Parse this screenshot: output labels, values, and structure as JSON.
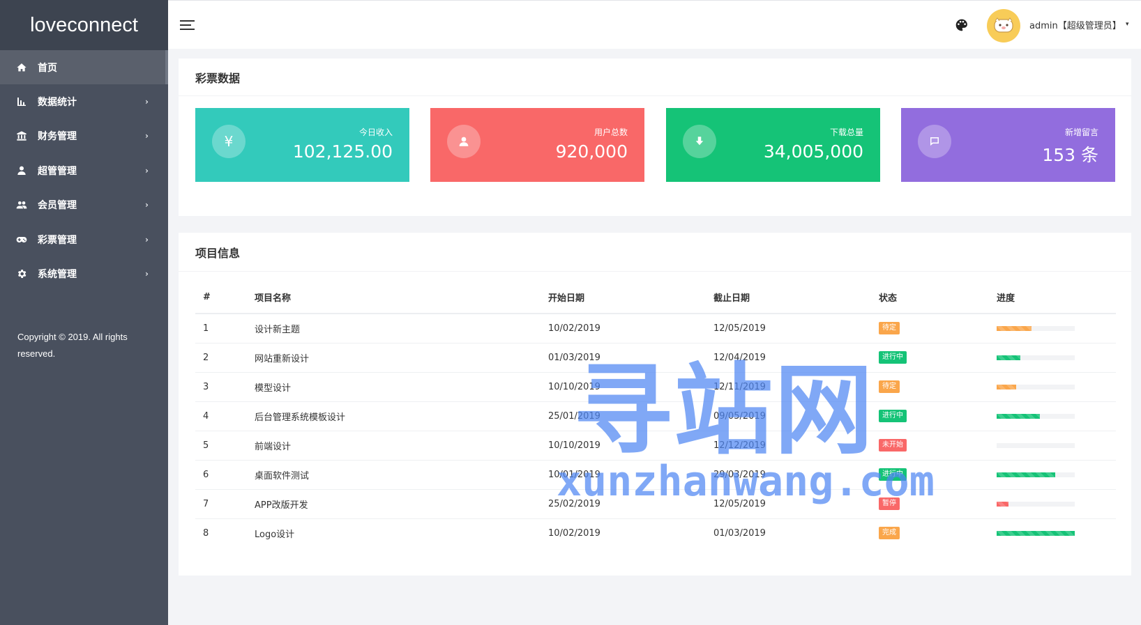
{
  "sidebar": {
    "logo": "loveconnect",
    "items": [
      {
        "label": "首页",
        "icon": "home-icon"
      },
      {
        "label": "数据统计",
        "icon": "bar-chart-icon"
      },
      {
        "label": "财务管理",
        "icon": "bank-icon"
      },
      {
        "label": "超管管理",
        "icon": "user-icon"
      },
      {
        "label": "会员管理",
        "icon": "users-icon"
      },
      {
        "label": "彩票管理",
        "icon": "gamepad-icon"
      },
      {
        "label": "系统管理",
        "icon": "gear-icon"
      }
    ],
    "copyright": "Copyright © 2019. All rights reserved."
  },
  "header": {
    "user": "admin【超级管理员】",
    "avatar_icon": "cartoon-avatar-icon",
    "palette_icon": "palette-icon",
    "caret": "▾"
  },
  "stats": {
    "title": "彩票数据",
    "cards": [
      {
        "label": "今日收入",
        "value": "102,125.00",
        "icon": "yen-icon",
        "glyph": "¥",
        "color": "#33cabb"
      },
      {
        "label": "用户总数",
        "value": "920,000",
        "icon": "user-icon",
        "color": "#f96868"
      },
      {
        "label": "下载总量",
        "value": "34,005,000",
        "icon": "download-icon",
        "color": "#15c377"
      },
      {
        "label": "新增留言",
        "value": "153 条",
        "icon": "message-icon",
        "color": "#926dde"
      }
    ]
  },
  "projects": {
    "title": "项目信息",
    "columns": [
      "#",
      "项目名称",
      "开始日期",
      "截止日期",
      "状态",
      "进度"
    ],
    "rows": [
      {
        "id": "1",
        "name": "设计新主题",
        "start": "10/02/2019",
        "end": "12/05/2019",
        "status": "待定",
        "status_color": "#faa64b",
        "progress": 45,
        "bar_color": "#faa64b"
      },
      {
        "id": "2",
        "name": "网站重新设计",
        "start": "01/03/2019",
        "end": "12/04/2019",
        "status": "进行中",
        "status_color": "#15c377",
        "progress": 30,
        "bar_color": "#15c377"
      },
      {
        "id": "3",
        "name": "模型设计",
        "start": "10/10/2019",
        "end": "12/11/2019",
        "status": "待定",
        "status_color": "#faa64b",
        "progress": 25,
        "bar_color": "#faa64b"
      },
      {
        "id": "4",
        "name": "后台管理系统模板设计",
        "start": "25/01/2019",
        "end": "09/05/2019",
        "status": "进行中",
        "status_color": "#15c377",
        "progress": 55,
        "bar_color": "#15c377"
      },
      {
        "id": "5",
        "name": "前端设计",
        "start": "10/10/2019",
        "end": "12/12/2019",
        "status": "未开始",
        "status_color": "#f96868",
        "progress": 0,
        "bar_color": "#f96868"
      },
      {
        "id": "6",
        "name": "桌面软件测试",
        "start": "10/01/2019",
        "end": "29/03/2019",
        "status": "进行中",
        "status_color": "#15c377",
        "progress": 75,
        "bar_color": "#15c377"
      },
      {
        "id": "7",
        "name": "APP改版开发",
        "start": "25/02/2019",
        "end": "12/05/2019",
        "status": "暂停",
        "status_color": "#f96868",
        "progress": 15,
        "bar_color": "#f96868"
      },
      {
        "id": "8",
        "name": "Logo设计",
        "start": "10/02/2019",
        "end": "01/03/2019",
        "status": "完成",
        "status_color": "#faa64b",
        "progress": 100,
        "bar_color": "#15c377"
      }
    ]
  },
  "watermark": {
    "text": "寻站网",
    "url": "xunzhanwang.com"
  }
}
